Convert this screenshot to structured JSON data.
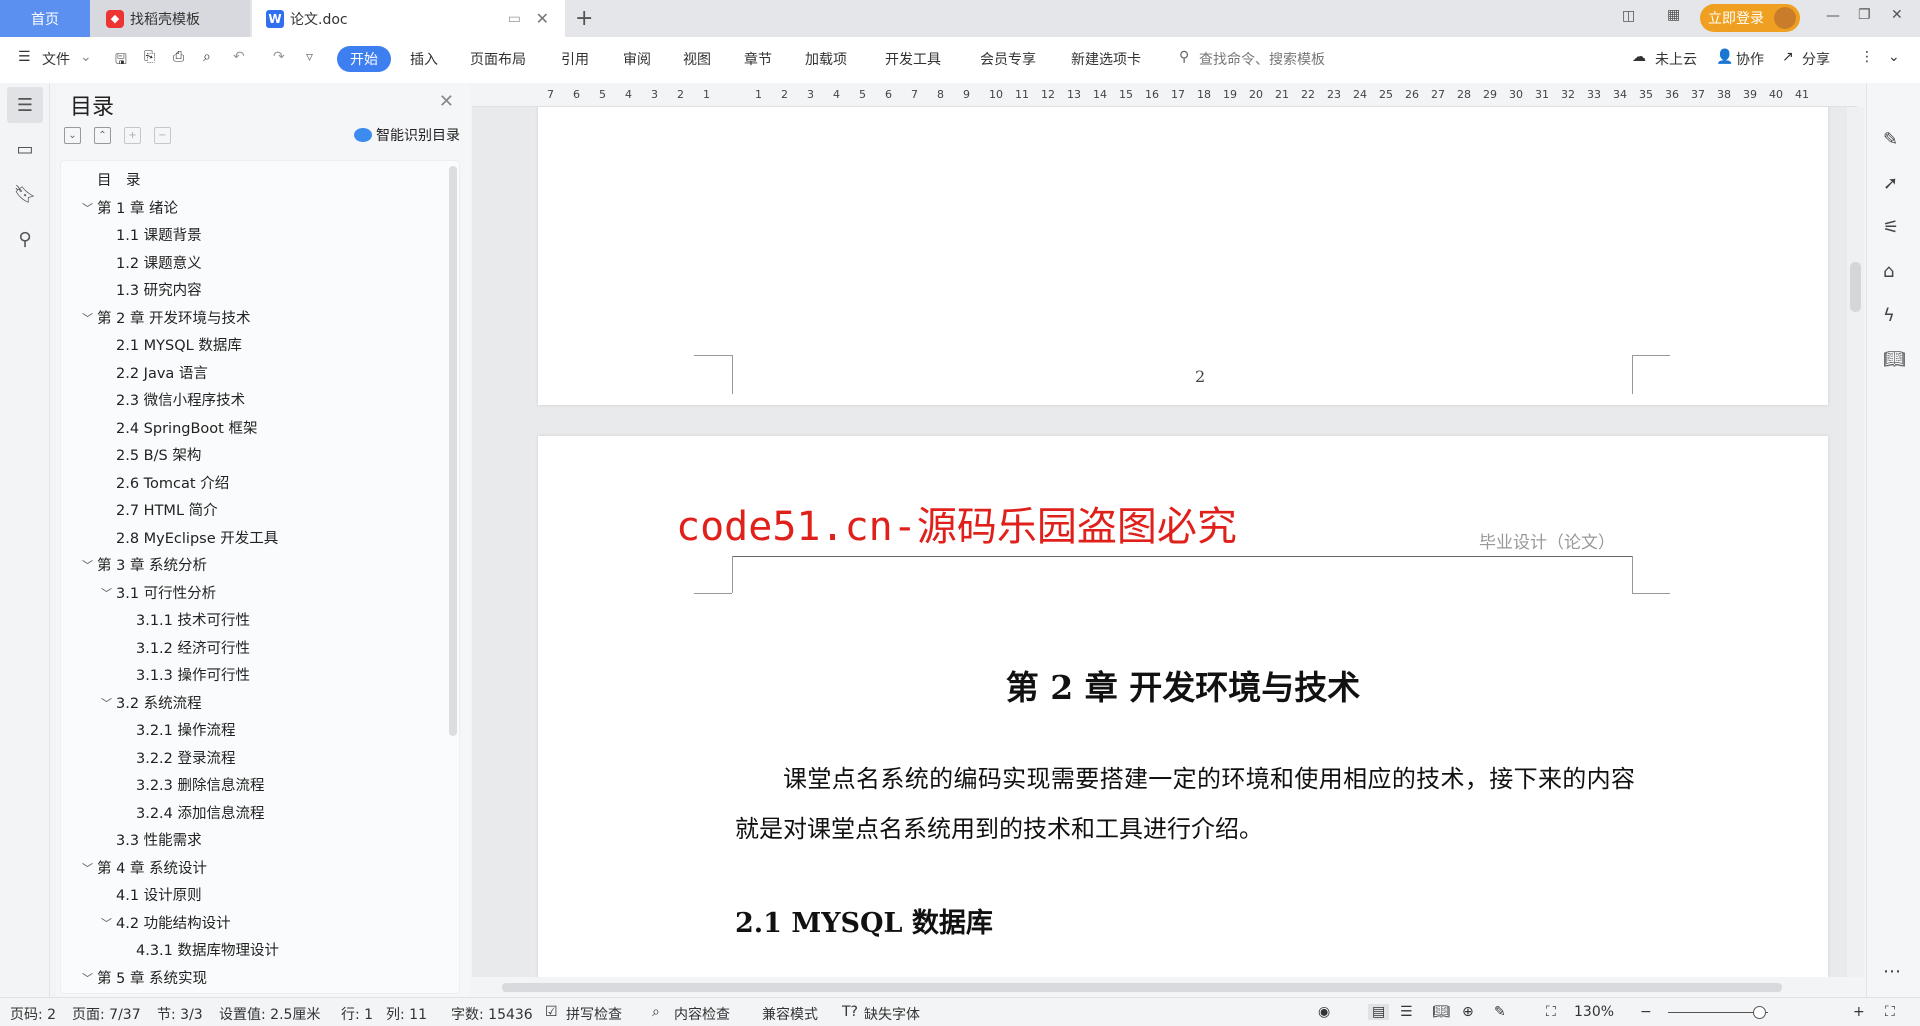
{
  "tabs": {
    "home": "首页",
    "template": "找稻壳模板",
    "doc": "论文.doc",
    "new_tab": "+"
  },
  "window": {
    "login": "立即登录",
    "minimize": "—",
    "restore": "❐",
    "close": "✕"
  },
  "toolbar": {
    "file": "文件",
    "menus": [
      "开始",
      "插入",
      "页面布局",
      "引用",
      "审阅",
      "视图",
      "章节",
      "加载项",
      "开发工具",
      "会员专享",
      "新建选项卡"
    ],
    "search": "查找命令、搜索模板",
    "cloud": "未上云",
    "collab": "协作",
    "share": "分享"
  },
  "toc": {
    "title": "目录",
    "smart": "智能识别目录",
    "items": [
      {
        "label": "目　录",
        "level": 0,
        "chev": false
      },
      {
        "label": "第 1 章  绪论",
        "level": 0,
        "chev": true
      },
      {
        "label": "1.1  课题背景",
        "level": 1
      },
      {
        "label": "1.2  课题意义",
        "level": 1
      },
      {
        "label": "1.3  研究内容",
        "level": 1
      },
      {
        "label": "第 2 章  开发环境与技术",
        "level": 0,
        "chev": true
      },
      {
        "label": "2.1 MYSQL 数据库",
        "level": 1
      },
      {
        "label": "2.2 Java 语言",
        "level": 1
      },
      {
        "label": "2.3  微信小程序技术",
        "level": 1
      },
      {
        "label": "2.4 SpringBoot 框架",
        "level": 1
      },
      {
        "label": "2.5 B/S 架构",
        "level": 1
      },
      {
        "label": "2.6 Tomcat  介绍",
        "level": 1
      },
      {
        "label": "2.7 HTML 简介",
        "level": 1
      },
      {
        "label": "2.8 MyEclipse 开发工具",
        "level": 1
      },
      {
        "label": "第 3 章  系统分析",
        "level": 0,
        "chev": true
      },
      {
        "label": "3.1  可行性分析",
        "level": 1,
        "chev": true
      },
      {
        "label": "3.1.1  技术可行性",
        "level": 2
      },
      {
        "label": "3.1.2  经济可行性",
        "level": 2
      },
      {
        "label": "3.1.3  操作可行性",
        "level": 2
      },
      {
        "label": "3.2  系统流程",
        "level": 1,
        "chev": true
      },
      {
        "label": "3.2.1  操作流程",
        "level": 2
      },
      {
        "label": "3.2.2  登录流程",
        "level": 2
      },
      {
        "label": "3.2.3  删除信息流程",
        "level": 2
      },
      {
        "label": "3.2.4  添加信息流程",
        "level": 2
      },
      {
        "label": "3.3  性能需求",
        "level": 1
      },
      {
        "label": "第 4 章  系统设计",
        "level": 0,
        "chev": true
      },
      {
        "label": "4.1  设计原则",
        "level": 1
      },
      {
        "label": "4.2  功能结构设计",
        "level": 1,
        "chev": true
      },
      {
        "label": "4.3.1  数据库物理设计",
        "level": 2
      },
      {
        "label": "第 5 章  系统实现",
        "level": 0,
        "chev": true
      }
    ]
  },
  "ruler": {
    "left": [
      "7",
      "6",
      "5",
      "4",
      "3",
      "2",
      "1"
    ],
    "right": [
      "1",
      "2",
      "3",
      "4",
      "5",
      "6",
      "7",
      "8",
      "9",
      "10",
      "11",
      "12",
      "13",
      "14",
      "15",
      "16",
      "17",
      "18",
      "19",
      "20",
      "21",
      "22",
      "23",
      "24",
      "25",
      "26",
      "27",
      "28",
      "29",
      "30",
      "31",
      "32",
      "33",
      "34",
      "35",
      "36",
      "37",
      "38",
      "39",
      "40",
      "41"
    ]
  },
  "document": {
    "page_number": "2",
    "watermark": "code51.cn-源码乐园盗图必究",
    "header": "毕业设计（论文）",
    "chapter_title": "第 2 章  开发环境与技术",
    "paragraph": "课堂点名系统的编码实现需要搭建一定的环境和使用相应的技术，接下来的内容就是对课堂点名系统用到的技术和工具进行介绍。",
    "section_title": "2.1 MYSQL 数据库",
    "watermark_color": "#e0201a"
  },
  "status": {
    "page": "页码: 2",
    "pages": "页面: 7/37",
    "section": "节: 3/3",
    "setting": "设置值: 2.5厘米",
    "row": "行: 1",
    "col": "列: 11",
    "words": "字数: 15436",
    "spell": "拼写检查",
    "content": "内容检查",
    "compat": "兼容模式",
    "missing_font": "缺失字体",
    "zoom": "130%",
    "zoom_level": 130
  }
}
